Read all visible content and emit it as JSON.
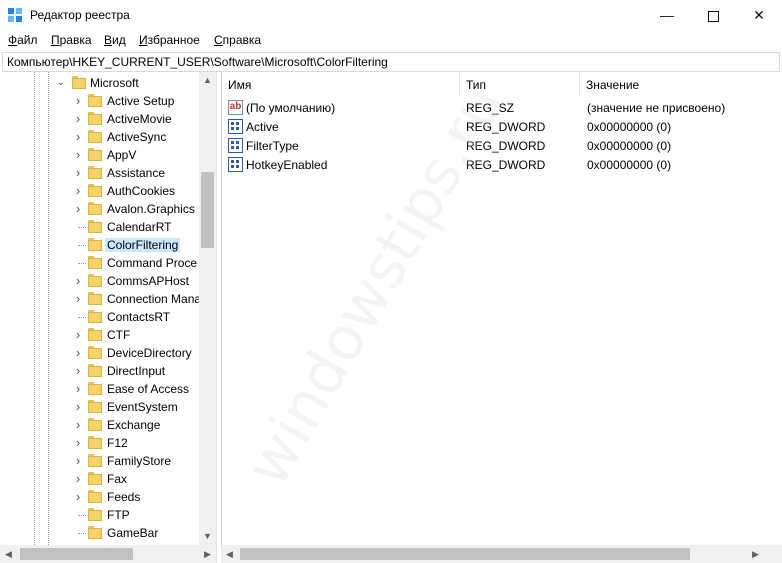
{
  "window": {
    "title": "Редактор реестра",
    "minimize": "—",
    "close": "✕"
  },
  "menu": [
    {
      "underline": "Ф",
      "rest": "айл"
    },
    {
      "underline": "П",
      "rest": "равка"
    },
    {
      "underline": "В",
      "rest": "ид"
    },
    {
      "underline": "И",
      "rest": "збранное"
    },
    {
      "underline": "С",
      "rest": "правка"
    }
  ],
  "address": "Компьютер\\HKEY_CURRENT_USER\\Software\\Microsoft\\ColorFiltering",
  "tree": {
    "parent": "Microsoft",
    "children": [
      {
        "label": "Active Setup",
        "expandable": true
      },
      {
        "label": "ActiveMovie",
        "expandable": true
      },
      {
        "label": "ActiveSync",
        "expandable": true
      },
      {
        "label": "AppV",
        "expandable": true
      },
      {
        "label": "Assistance",
        "expandable": true
      },
      {
        "label": "AuthCookies",
        "expandable": true
      },
      {
        "label": "Avalon.Graphics",
        "expandable": true
      },
      {
        "label": "CalendarRT",
        "expandable": false
      },
      {
        "label": "ColorFiltering",
        "expandable": false,
        "selected": true
      },
      {
        "label": "Command Proce",
        "expandable": false
      },
      {
        "label": "CommsAPHost",
        "expandable": true
      },
      {
        "label": "Connection Mana",
        "expandable": true
      },
      {
        "label": "ContactsRT",
        "expandable": false
      },
      {
        "label": "CTF",
        "expandable": true
      },
      {
        "label": "DeviceDirectory",
        "expandable": true
      },
      {
        "label": "DirectInput",
        "expandable": true
      },
      {
        "label": "Ease of Access",
        "expandable": true
      },
      {
        "label": "EventSystem",
        "expandable": true
      },
      {
        "label": "Exchange",
        "expandable": true
      },
      {
        "label": "F12",
        "expandable": true
      },
      {
        "label": "FamilyStore",
        "expandable": true
      },
      {
        "label": "Fax",
        "expandable": true
      },
      {
        "label": "Feeds",
        "expandable": true
      },
      {
        "label": "FTP",
        "expandable": false
      },
      {
        "label": "GameBar",
        "expandable": false
      }
    ]
  },
  "list": {
    "headers": {
      "name": "Имя",
      "type": "Тип",
      "value": "Значение"
    },
    "rows": [
      {
        "name": "(По умолчанию)",
        "type": "REG_SZ",
        "value": "(значение не присвоено)",
        "icon": "string-value-icon"
      },
      {
        "name": "Active",
        "type": "REG_DWORD",
        "value": "0x00000000 (0)",
        "icon": "dword-value-icon"
      },
      {
        "name": "FilterType",
        "type": "REG_DWORD",
        "value": "0x00000000 (0)",
        "icon": "dword-value-icon"
      },
      {
        "name": "HotkeyEnabled",
        "type": "REG_DWORD",
        "value": "0x00000000 (0)",
        "icon": "dword-value-icon"
      }
    ]
  },
  "watermark": "windowstips.ru",
  "colors": {
    "selection": "#cce8ff",
    "folder": "#f6d366",
    "scrollbar_thumb": "#c1c1c1"
  }
}
